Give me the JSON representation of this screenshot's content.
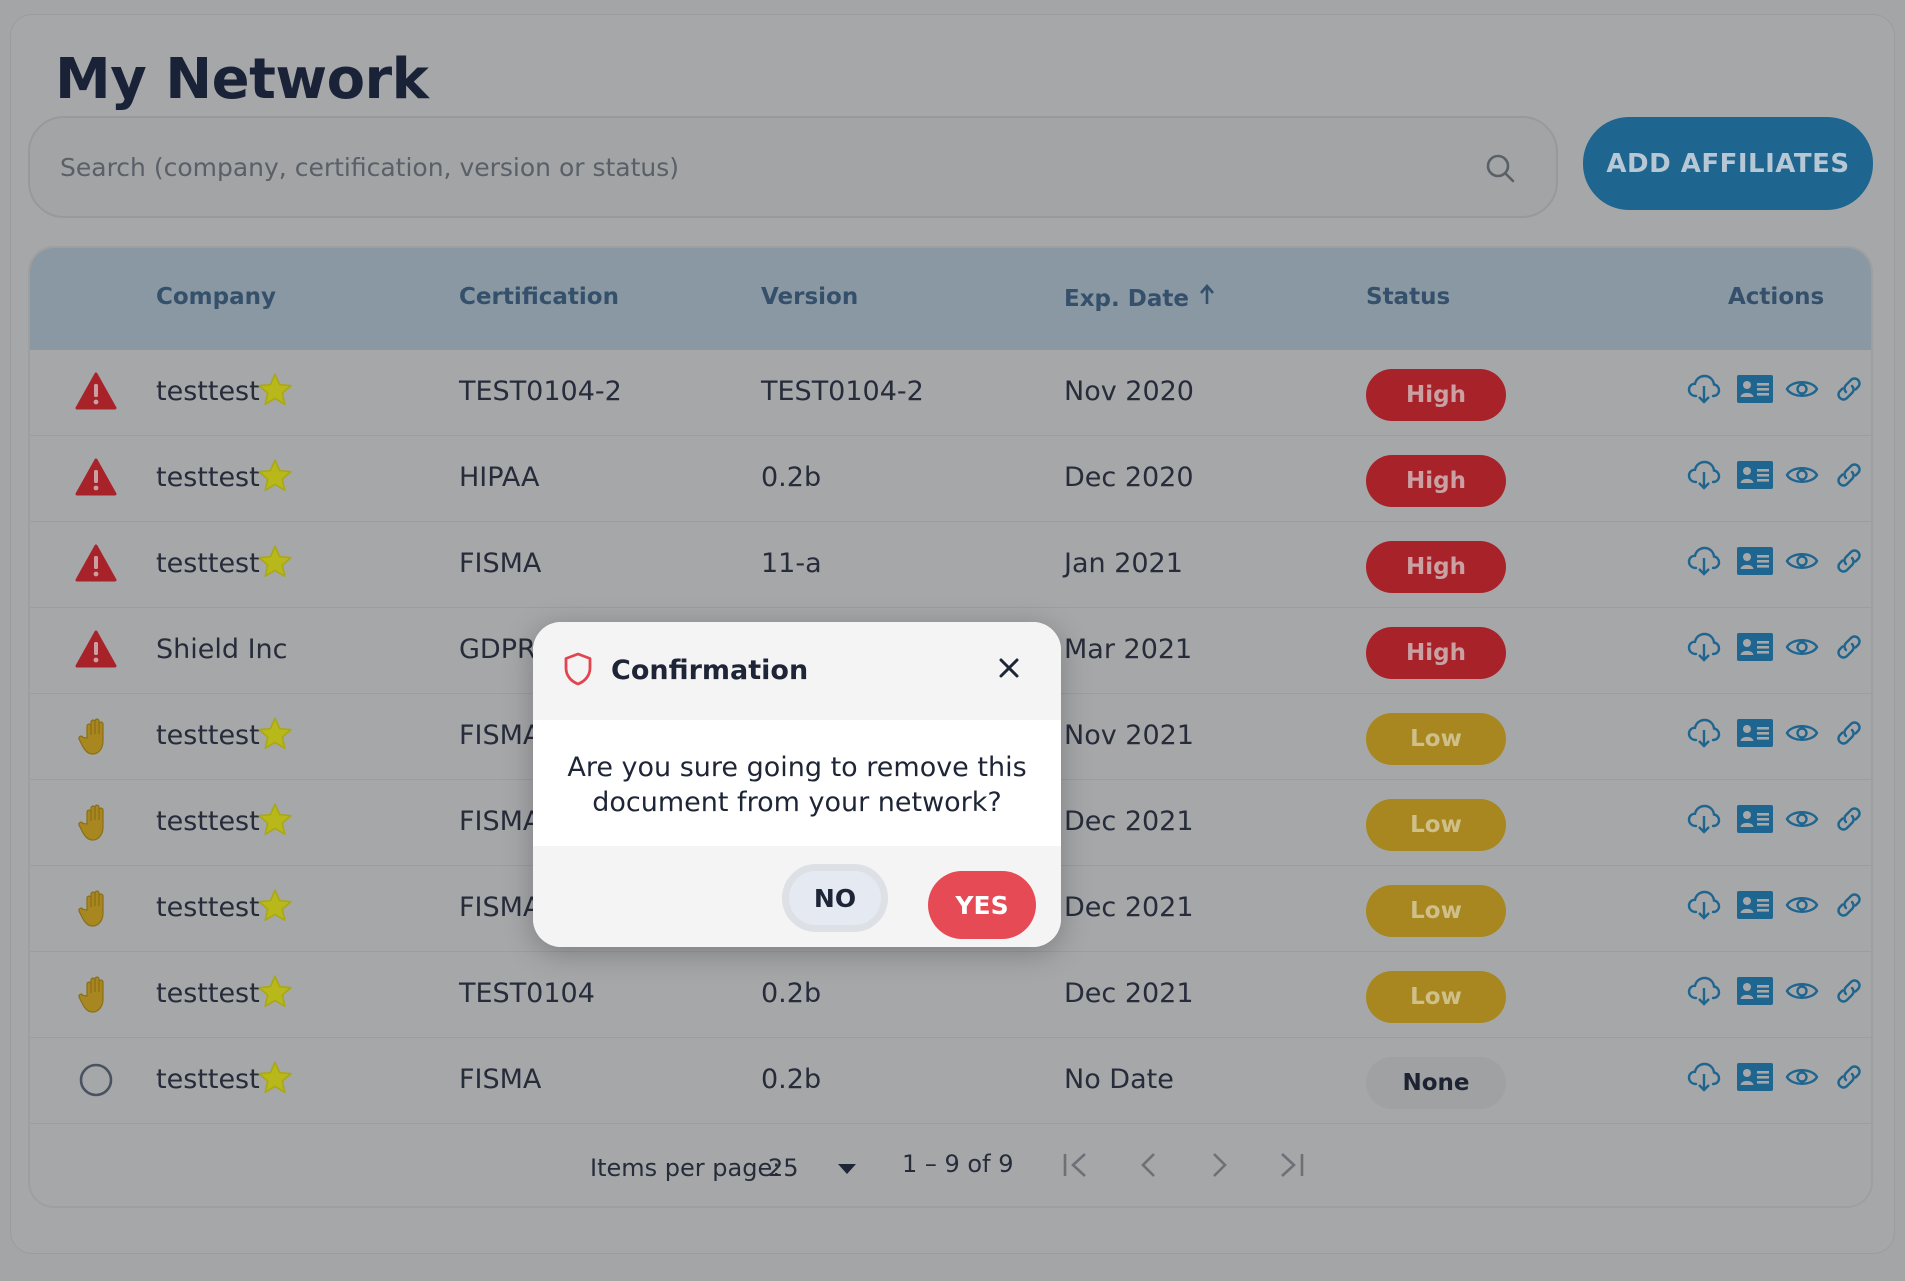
{
  "page": {
    "title": "My Network"
  },
  "search": {
    "placeholder": "Search (company, certification, version or status)"
  },
  "toolbar": {
    "add_label": "ADD AFFILIATES"
  },
  "table": {
    "headers": {
      "company": "Company",
      "certification": "Certification",
      "version": "Version",
      "exp_date": "Exp. Date",
      "status": "Status",
      "actions": "Actions"
    },
    "sort": {
      "column": "exp_date",
      "direction": "ascending"
    },
    "rows": [
      {
        "risk_icon": "warning-triangle-icon",
        "company": "testtest",
        "favorite": true,
        "certification": "TEST0104-2",
        "version": "TEST0104-2",
        "exp_date": "Nov 2020",
        "status": "High"
      },
      {
        "risk_icon": "warning-triangle-icon",
        "company": "testtest",
        "favorite": true,
        "certification": "HIPAA",
        "version": "0.2b",
        "exp_date": "Dec 2020",
        "status": "High"
      },
      {
        "risk_icon": "warning-triangle-icon",
        "company": "testtest",
        "favorite": true,
        "certification": "FISMA",
        "version": "11-a",
        "exp_date": "Jan 2021",
        "status": "High"
      },
      {
        "risk_icon": "warning-triangle-icon",
        "company": "Shield Inc",
        "favorite": false,
        "certification": "GDPR",
        "version": "",
        "exp_date": "Mar 2021",
        "status": "High"
      },
      {
        "risk_icon": "hand-icon",
        "company": "testtest",
        "favorite": true,
        "certification": "FISMA",
        "version": "",
        "exp_date": "Nov 2021",
        "status": "Low"
      },
      {
        "risk_icon": "hand-icon",
        "company": "testtest",
        "favorite": true,
        "certification": "FISMA",
        "version": "",
        "exp_date": "Dec 2021",
        "status": "Low"
      },
      {
        "risk_icon": "hand-icon",
        "company": "testtest",
        "favorite": true,
        "certification": "FISMA",
        "version": "",
        "exp_date": "Dec 2021",
        "status": "Low"
      },
      {
        "risk_icon": "hand-icon",
        "company": "testtest",
        "favorite": true,
        "certification": "TEST0104",
        "version": "0.2b",
        "exp_date": "Dec 2021",
        "status": "Low"
      },
      {
        "risk_icon": "circle-icon",
        "company": "testtest",
        "favorite": true,
        "certification": "FISMA",
        "version": "0.2b",
        "exp_date": "No Date",
        "status": "None"
      }
    ],
    "action_icons": [
      "cloud-download-icon",
      "contact-card-icon",
      "eye-icon",
      "link-icon"
    ]
  },
  "paginator": {
    "items_per_page_label": "Items per page:",
    "items_per_page_value": "25",
    "range_label": "1 – 9 of 9"
  },
  "modal": {
    "title": "Confirmation",
    "message_line1": "Are you sure going to remove this",
    "message_line2": "document from your network?",
    "no_label": "NO",
    "yes_label": "YES"
  },
  "colors": {
    "high": "#a8222a",
    "low": "#a88720",
    "accent": "#1e6590",
    "yes_button": "#e64a55",
    "star": "#b8b81a"
  }
}
